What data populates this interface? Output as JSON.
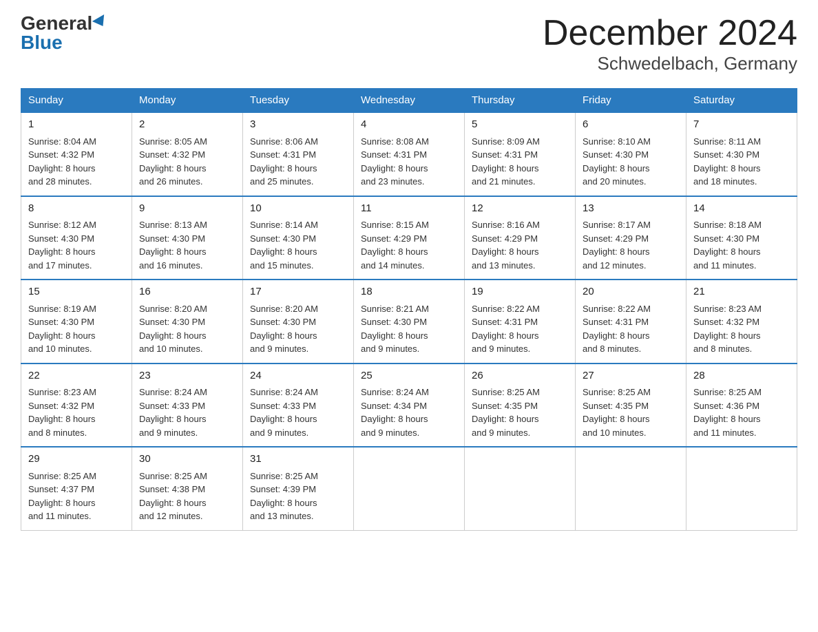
{
  "header": {
    "logo_general": "General",
    "logo_blue": "Blue",
    "month_title": "December 2024",
    "location": "Schwedelbach, Germany"
  },
  "days_of_week": [
    "Sunday",
    "Monday",
    "Tuesday",
    "Wednesday",
    "Thursday",
    "Friday",
    "Saturday"
  ],
  "weeks": [
    [
      {
        "day": "1",
        "sunrise": "8:04 AM",
        "sunset": "4:32 PM",
        "daylight": "8 hours and 28 minutes."
      },
      {
        "day": "2",
        "sunrise": "8:05 AM",
        "sunset": "4:32 PM",
        "daylight": "8 hours and 26 minutes."
      },
      {
        "day": "3",
        "sunrise": "8:06 AM",
        "sunset": "4:31 PM",
        "daylight": "8 hours and 25 minutes."
      },
      {
        "day": "4",
        "sunrise": "8:08 AM",
        "sunset": "4:31 PM",
        "daylight": "8 hours and 23 minutes."
      },
      {
        "day": "5",
        "sunrise": "8:09 AM",
        "sunset": "4:31 PM",
        "daylight": "8 hours and 21 minutes."
      },
      {
        "day": "6",
        "sunrise": "8:10 AM",
        "sunset": "4:30 PM",
        "daylight": "8 hours and 20 minutes."
      },
      {
        "day": "7",
        "sunrise": "8:11 AM",
        "sunset": "4:30 PM",
        "daylight": "8 hours and 18 minutes."
      }
    ],
    [
      {
        "day": "8",
        "sunrise": "8:12 AM",
        "sunset": "4:30 PM",
        "daylight": "8 hours and 17 minutes."
      },
      {
        "day": "9",
        "sunrise": "8:13 AM",
        "sunset": "4:30 PM",
        "daylight": "8 hours and 16 minutes."
      },
      {
        "day": "10",
        "sunrise": "8:14 AM",
        "sunset": "4:30 PM",
        "daylight": "8 hours and 15 minutes."
      },
      {
        "day": "11",
        "sunrise": "8:15 AM",
        "sunset": "4:29 PM",
        "daylight": "8 hours and 14 minutes."
      },
      {
        "day": "12",
        "sunrise": "8:16 AM",
        "sunset": "4:29 PM",
        "daylight": "8 hours and 13 minutes."
      },
      {
        "day": "13",
        "sunrise": "8:17 AM",
        "sunset": "4:29 PM",
        "daylight": "8 hours and 12 minutes."
      },
      {
        "day": "14",
        "sunrise": "8:18 AM",
        "sunset": "4:30 PM",
        "daylight": "8 hours and 11 minutes."
      }
    ],
    [
      {
        "day": "15",
        "sunrise": "8:19 AM",
        "sunset": "4:30 PM",
        "daylight": "8 hours and 10 minutes."
      },
      {
        "day": "16",
        "sunrise": "8:20 AM",
        "sunset": "4:30 PM",
        "daylight": "8 hours and 10 minutes."
      },
      {
        "day": "17",
        "sunrise": "8:20 AM",
        "sunset": "4:30 PM",
        "daylight": "8 hours and 9 minutes."
      },
      {
        "day": "18",
        "sunrise": "8:21 AM",
        "sunset": "4:30 PM",
        "daylight": "8 hours and 9 minutes."
      },
      {
        "day": "19",
        "sunrise": "8:22 AM",
        "sunset": "4:31 PM",
        "daylight": "8 hours and 9 minutes."
      },
      {
        "day": "20",
        "sunrise": "8:22 AM",
        "sunset": "4:31 PM",
        "daylight": "8 hours and 8 minutes."
      },
      {
        "day": "21",
        "sunrise": "8:23 AM",
        "sunset": "4:32 PM",
        "daylight": "8 hours and 8 minutes."
      }
    ],
    [
      {
        "day": "22",
        "sunrise": "8:23 AM",
        "sunset": "4:32 PM",
        "daylight": "8 hours and 8 minutes."
      },
      {
        "day": "23",
        "sunrise": "8:24 AM",
        "sunset": "4:33 PM",
        "daylight": "8 hours and 9 minutes."
      },
      {
        "day": "24",
        "sunrise": "8:24 AM",
        "sunset": "4:33 PM",
        "daylight": "8 hours and 9 minutes."
      },
      {
        "day": "25",
        "sunrise": "8:24 AM",
        "sunset": "4:34 PM",
        "daylight": "8 hours and 9 minutes."
      },
      {
        "day": "26",
        "sunrise": "8:25 AM",
        "sunset": "4:35 PM",
        "daylight": "8 hours and 9 minutes."
      },
      {
        "day": "27",
        "sunrise": "8:25 AM",
        "sunset": "4:35 PM",
        "daylight": "8 hours and 10 minutes."
      },
      {
        "day": "28",
        "sunrise": "8:25 AM",
        "sunset": "4:36 PM",
        "daylight": "8 hours and 11 minutes."
      }
    ],
    [
      {
        "day": "29",
        "sunrise": "8:25 AM",
        "sunset": "4:37 PM",
        "daylight": "8 hours and 11 minutes."
      },
      {
        "day": "30",
        "sunrise": "8:25 AM",
        "sunset": "4:38 PM",
        "daylight": "8 hours and 12 minutes."
      },
      {
        "day": "31",
        "sunrise": "8:25 AM",
        "sunset": "4:39 PM",
        "daylight": "8 hours and 13 minutes."
      },
      {
        "day": "",
        "sunrise": "",
        "sunset": "",
        "daylight": ""
      },
      {
        "day": "",
        "sunrise": "",
        "sunset": "",
        "daylight": ""
      },
      {
        "day": "",
        "sunrise": "",
        "sunset": "",
        "daylight": ""
      },
      {
        "day": "",
        "sunrise": "",
        "sunset": "",
        "daylight": ""
      }
    ]
  ],
  "labels": {
    "sunrise_prefix": "Sunrise: ",
    "sunset_prefix": "Sunset: ",
    "daylight_prefix": "Daylight: "
  }
}
